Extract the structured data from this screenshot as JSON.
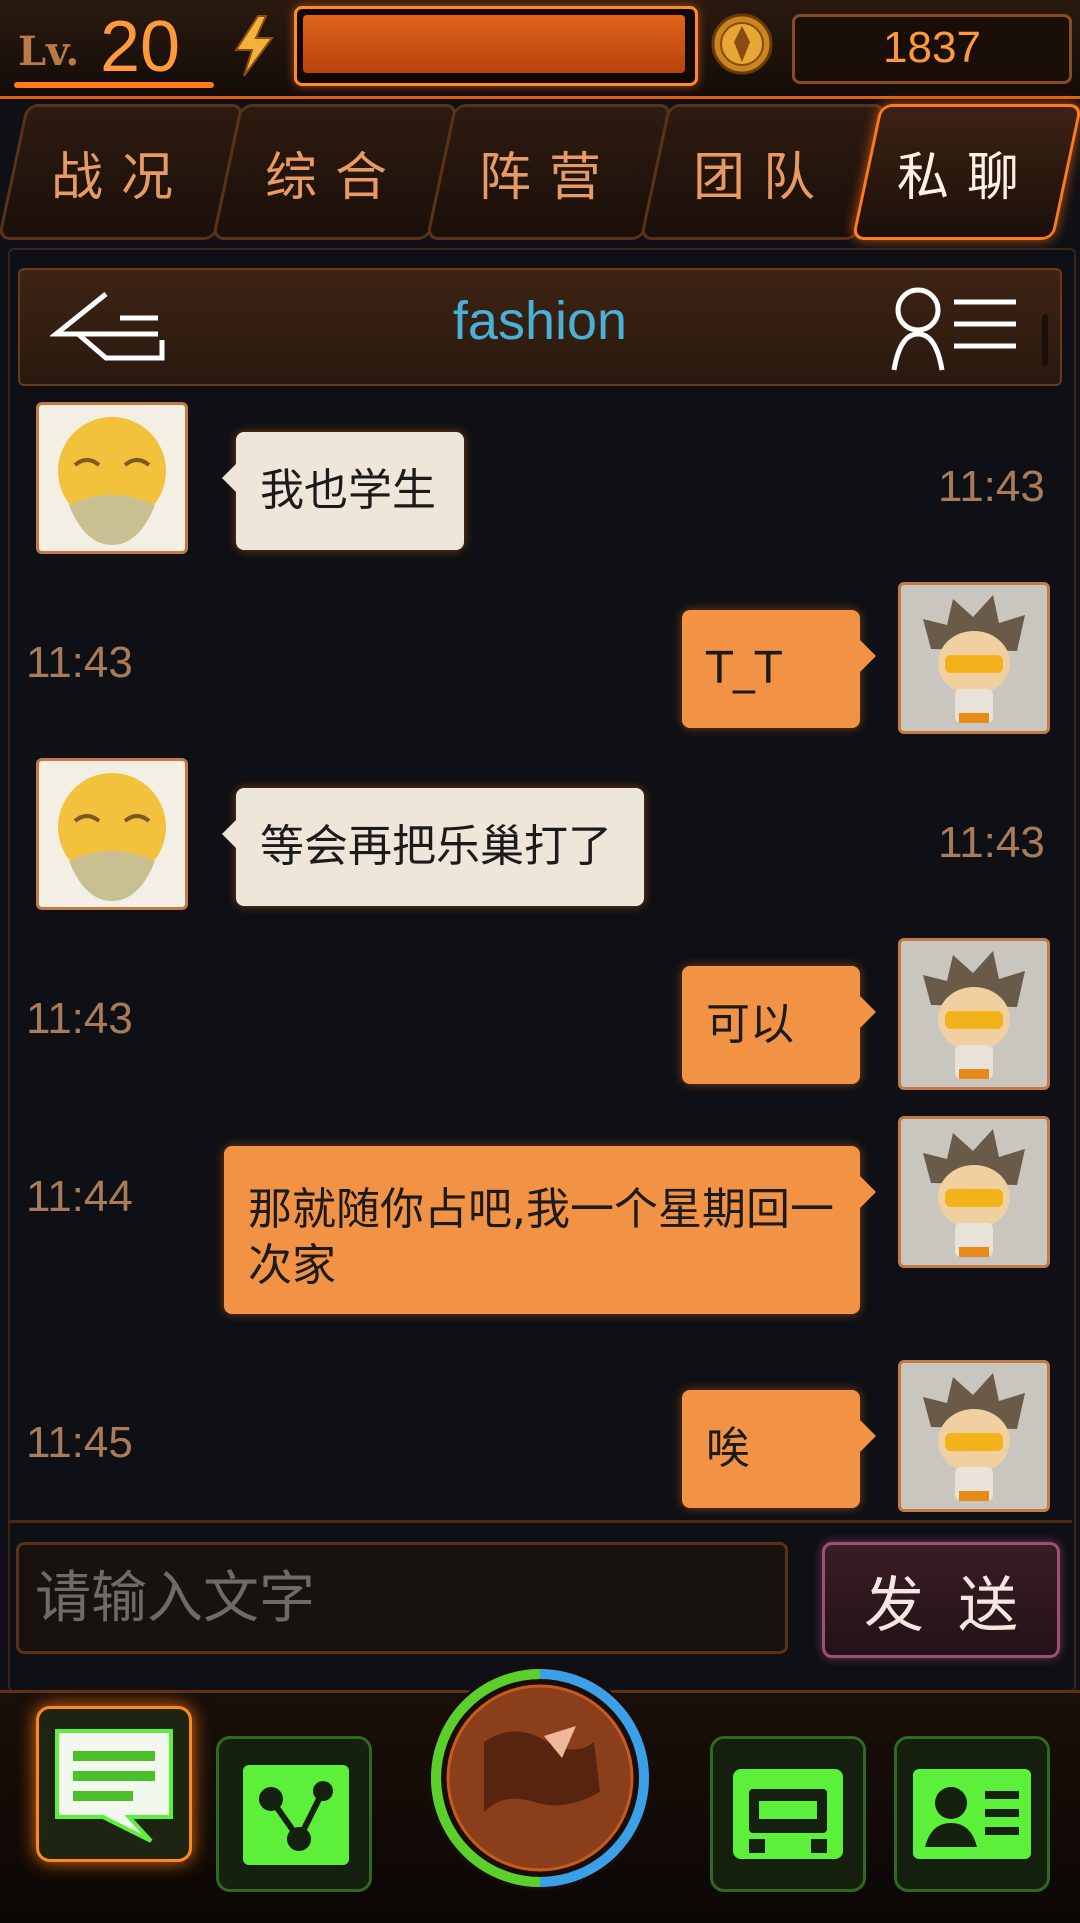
{
  "status_bar": {
    "level_prefix": "Lv.",
    "level": "20",
    "energy_fraction": 0.99,
    "gold": "1837"
  },
  "tabs": [
    {
      "label": "战况",
      "active": false
    },
    {
      "label": "综合",
      "active": false
    },
    {
      "label": "阵营",
      "active": false
    },
    {
      "label": "团队",
      "active": false
    },
    {
      "label": "私聊",
      "active": true
    }
  ],
  "chat": {
    "title": "fashion",
    "back_icon": "back-arrow-icon",
    "contacts_icon": "contact-list-icon"
  },
  "messages": [
    {
      "side": "friend",
      "text": "我也学生",
      "time": "11:43"
    },
    {
      "side": "me",
      "text": "T_T",
      "time": "11:43"
    },
    {
      "side": "friend",
      "text": "等会再把乐巢打了",
      "time": "11:43"
    },
    {
      "side": "me",
      "text": "可以",
      "time": "11:43"
    },
    {
      "side": "me",
      "text": "那就随你占吧,我一个星期回一次家",
      "time": "11:44"
    },
    {
      "side": "me",
      "text": "唉",
      "time": "11:45"
    }
  ],
  "composer": {
    "placeholder": "请输入文字",
    "send_label": "发送"
  },
  "bottom_nav": [
    {
      "icon": "chat-icon",
      "active": true
    },
    {
      "icon": "network-icon",
      "active": false
    },
    {
      "icon": "globe-icon",
      "active": false
    },
    {
      "icon": "shop-icon",
      "active": false
    },
    {
      "icon": "profile-card-icon",
      "active": false
    }
  ],
  "colors": {
    "accent_orange": "#ff7a1a",
    "my_bubble": "#f29245",
    "friend_bubble": "#efe6da",
    "title_blue": "#4ab0d6",
    "nav_green": "#5cf03a"
  }
}
